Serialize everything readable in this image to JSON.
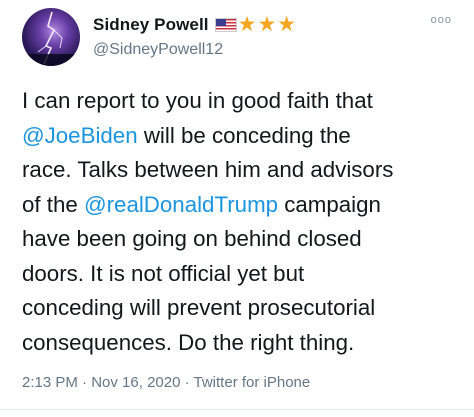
{
  "tweet": {
    "author": {
      "display_name": "Sidney Powell",
      "handle": "@SidneyPowell12",
      "badges": {
        "flag": "us-flag-icon",
        "stars": [
          "★",
          "★",
          "★"
        ],
        "star_color": "#f5a623"
      }
    },
    "more_menu": "ooo",
    "body": {
      "line1": "I can report to you in good faith that",
      "line2_mention": "@JoeBiden",
      "line2_text": " will be conceding the",
      "line3": "race. Talks between him and advisors",
      "line4_pre": "of the ",
      "line4_mention": "@realDonaldTrump",
      "line4_post": " campaign",
      "line5": "have been going on behind closed",
      "line6": "doors. It is not official yet but",
      "line7": "conceding will prevent prosecutorial",
      "line8": "consequences. Do the right thing."
    },
    "meta": {
      "time": "2:13 PM",
      "sep1": " · ",
      "date": "Nov 16, 2020",
      "sep2": " · ",
      "source": "Twitter for iPhone"
    },
    "colors": {
      "mention": "#1b95e0",
      "text": "#14171a",
      "secondary": "#657786"
    }
  }
}
